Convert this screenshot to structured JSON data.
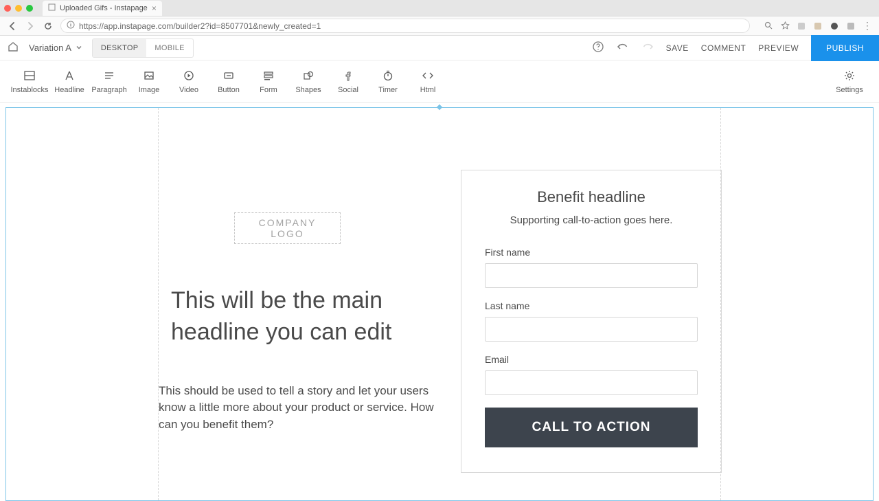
{
  "browser": {
    "tab_title": "Uploaded Gifs - Instapage",
    "url": "https://app.instapage.com/builder2?id=8507701&newly_created=1"
  },
  "appbar": {
    "variation_label": "Variation A",
    "viewport": {
      "desktop": "DESKTOP",
      "mobile": "MOBILE"
    },
    "actions": {
      "save": "SAVE",
      "comment": "COMMENT",
      "preview": "PREVIEW",
      "publish": "PUBLISH"
    }
  },
  "toolbox": {
    "items": [
      {
        "label": "Instablocks"
      },
      {
        "label": "Headline"
      },
      {
        "label": "Paragraph"
      },
      {
        "label": "Image"
      },
      {
        "label": "Video"
      },
      {
        "label": "Button"
      },
      {
        "label": "Form"
      },
      {
        "label": "Shapes"
      },
      {
        "label": "Social"
      },
      {
        "label": "Timer"
      },
      {
        "label": "Html"
      }
    ],
    "settings_label": "Settings"
  },
  "canvas": {
    "logo_text": "COMPANY LOGO",
    "hero_headline": "This will be the main headline you can edit",
    "hero_sub": "This should be used to tell a story and let your users know a little more about your product or service. How can you benefit them?",
    "form": {
      "title": "Benefit headline",
      "subtitle": "Supporting call-to-action goes here.",
      "fields": {
        "first_name_label": "First name",
        "last_name_label": "Last name",
        "email_label": "Email"
      },
      "cta": "CALL TO ACTION"
    }
  }
}
